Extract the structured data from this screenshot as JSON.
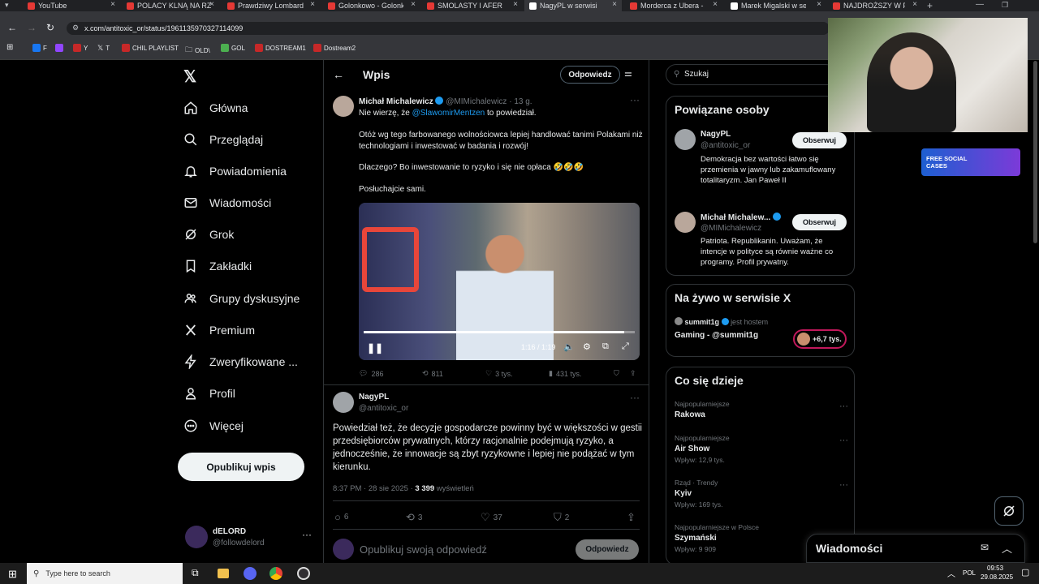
{
  "browser": {
    "tabs": [
      {
        "label": "YouTube"
      },
      {
        "label": "POLACY KLNĄ NA RZ"
      },
      {
        "label": "Prawdziwy Lombard"
      },
      {
        "label": "Golonkowo - Golonk"
      },
      {
        "label": "SMOLASTY I AFERA L"
      },
      {
        "label": "NagyPL w serwisi"
      },
      {
        "label": "Morderca z Ubera - Y"
      },
      {
        "label": "Marek Migalski w ser"
      },
      {
        "label": "NAJDROŻSZY W POL"
      }
    ],
    "url": "x.com/antitoxic_or/status/1961135970327114099",
    "bookmarks": [
      "F",
      "Y",
      "T",
      "CHIL PLAYLIST",
      "OLD\\",
      "GOL",
      "DOSTREAM1",
      "Dostream2"
    ]
  },
  "nav": {
    "items": [
      "Główna",
      "Przeglądaj",
      "Powiadomienia",
      "Wiadomości",
      "Grok",
      "Zakładki",
      "Grupy dyskusyjne",
      "Premium",
      "Zweryfikowane ...",
      "Profil",
      "Więcej"
    ],
    "post_button": "Opublikuj wpis",
    "account_name": "dELORD",
    "account_handle": "@followdelord"
  },
  "header": {
    "title": "Wpis",
    "reply_button": "Odpowiedz"
  },
  "quoted_tweet": {
    "author": "Michał Michalewicz",
    "handle": "@MIMichalewicz",
    "time": "· 13 g.",
    "line1_pre": "Nie wierzę, że ",
    "line1_mention": "@SlawomirMentzen",
    "line1_post": " to powiedział.",
    "para1": "Otóż wg tego farbowanego wolnościowca lepiej handlować tanimi Polakami niż technologiami i inwestować w badania i rozwój!",
    "para2": "Dlaczego? Bo inwestowanie to ryzyko i się nie opłaca 🤣🤣🤣",
    "para3": "Posłuchajcie sami.",
    "video_time": "1:16 / 1:19",
    "video_progress": 0.96,
    "replies": "286",
    "reposts": "811",
    "likes": "3 tys.",
    "views": "431 tys."
  },
  "main_tweet": {
    "author": "NagyPL",
    "handle": "@antitoxic_or",
    "text": "Powiedział też, że decyzje gospodarcze powinny być w większości w gestii przedsiębiorców prywatnych, którzy racjonalnie podejmują ryzyko, a jednocześnie, że innowacje są zbyt ryzykowne i lepiej nie podążać w tym kierunku.",
    "meta_time": "8:37 PM · 28 sie 2025 · ",
    "meta_views": "3 399",
    "meta_views_label": " wyświetleń",
    "replies": "6",
    "reposts": "3",
    "likes": "37",
    "bookmarks": "2"
  },
  "reply_box": {
    "placeholder": "Opublikuj swoją odpowiedź",
    "button": "Odpowiedz"
  },
  "search": {
    "placeholder": "Szukaj"
  },
  "related": {
    "title": "Powiązane osoby",
    "people": [
      {
        "name": "NagyPL",
        "handle": "@antitoxic_or",
        "bio": "Demokracja bez wartości łatwo się przemienia w jawny lub zakamuflowany totalitaryzm. Jan Paweł II",
        "follow": "Obserwuj"
      },
      {
        "name": "Michał Michalew...",
        "handle": "@MIMichalewicz",
        "bio": "Patriota. Republikanin. Uważam, że intencje w polityce są równie ważne co programy. Profil prywatny.",
        "follow": "Obserwuj"
      }
    ]
  },
  "live": {
    "title": "Na żywo w serwisie X",
    "host_name": "summit1g",
    "host_suffix": "jest hostem",
    "stream_title": "Gaming - @summit1g",
    "listeners": "+6,7 tys."
  },
  "trends": {
    "title": "Co się dzieje",
    "items": [
      {
        "category": "Najpopularniejsze",
        "name": "Rakowa",
        "posts": ""
      },
      {
        "category": "Najpopularniejsze",
        "name": "Air Show",
        "posts": "Wpływ: 12,9 tys."
      },
      {
        "category": "Rząd · Trendy",
        "name": "Kyiv",
        "posts": "Wpływ: 169 tys."
      },
      {
        "category": "Najpopularniejsze w Polsce",
        "name": "Szymański",
        "posts": "Wpływ: 9 909"
      }
    ]
  },
  "messages_drawer": {
    "title": "Wiadomości"
  },
  "taskbar": {
    "search_placeholder": "Type here to search",
    "lang": "POL",
    "time": "09:53",
    "date": "29.08.2025"
  },
  "overlay": {
    "badge_text": "FREE SOCIAL CASES"
  },
  "colors": {
    "accent": "#1d9bf0",
    "background": "#000000",
    "border": "#2f3336"
  }
}
